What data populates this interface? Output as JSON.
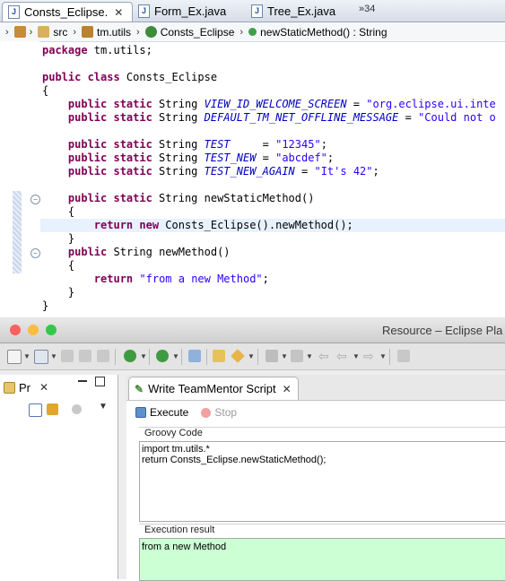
{
  "editor": {
    "tabs": [
      {
        "label": "Consts_Eclipse.",
        "active": true
      },
      {
        "label": "Form_Ex.java",
        "active": false
      },
      {
        "label": "Tree_Ex.java",
        "active": false
      }
    ],
    "overflow_label": "»34",
    "breadcrumb": {
      "src": "src",
      "package": "tm.utils",
      "class": "Consts_Eclipse",
      "method": "newStaticMethod() : String"
    }
  },
  "window": {
    "title": "Resource – Eclipse Pla",
    "left_view_tab": "Pr",
    "script_tab": "Write TeamMentor Script",
    "execute_label": "Execute",
    "stop_label": "Stop",
    "groovy_legend": "Groovy Code",
    "groovy_code": [
      "import tm.utils.*",
      "return Consts_Eclipse.newStaticMethod();"
    ],
    "result_legend": "Execution result",
    "result_text": "from a new Method",
    "colors": {
      "result_bg": "#ccffd4",
      "close": "#fc615d",
      "minimize": "#fdbc40",
      "zoom": "#34c84a"
    }
  }
}
